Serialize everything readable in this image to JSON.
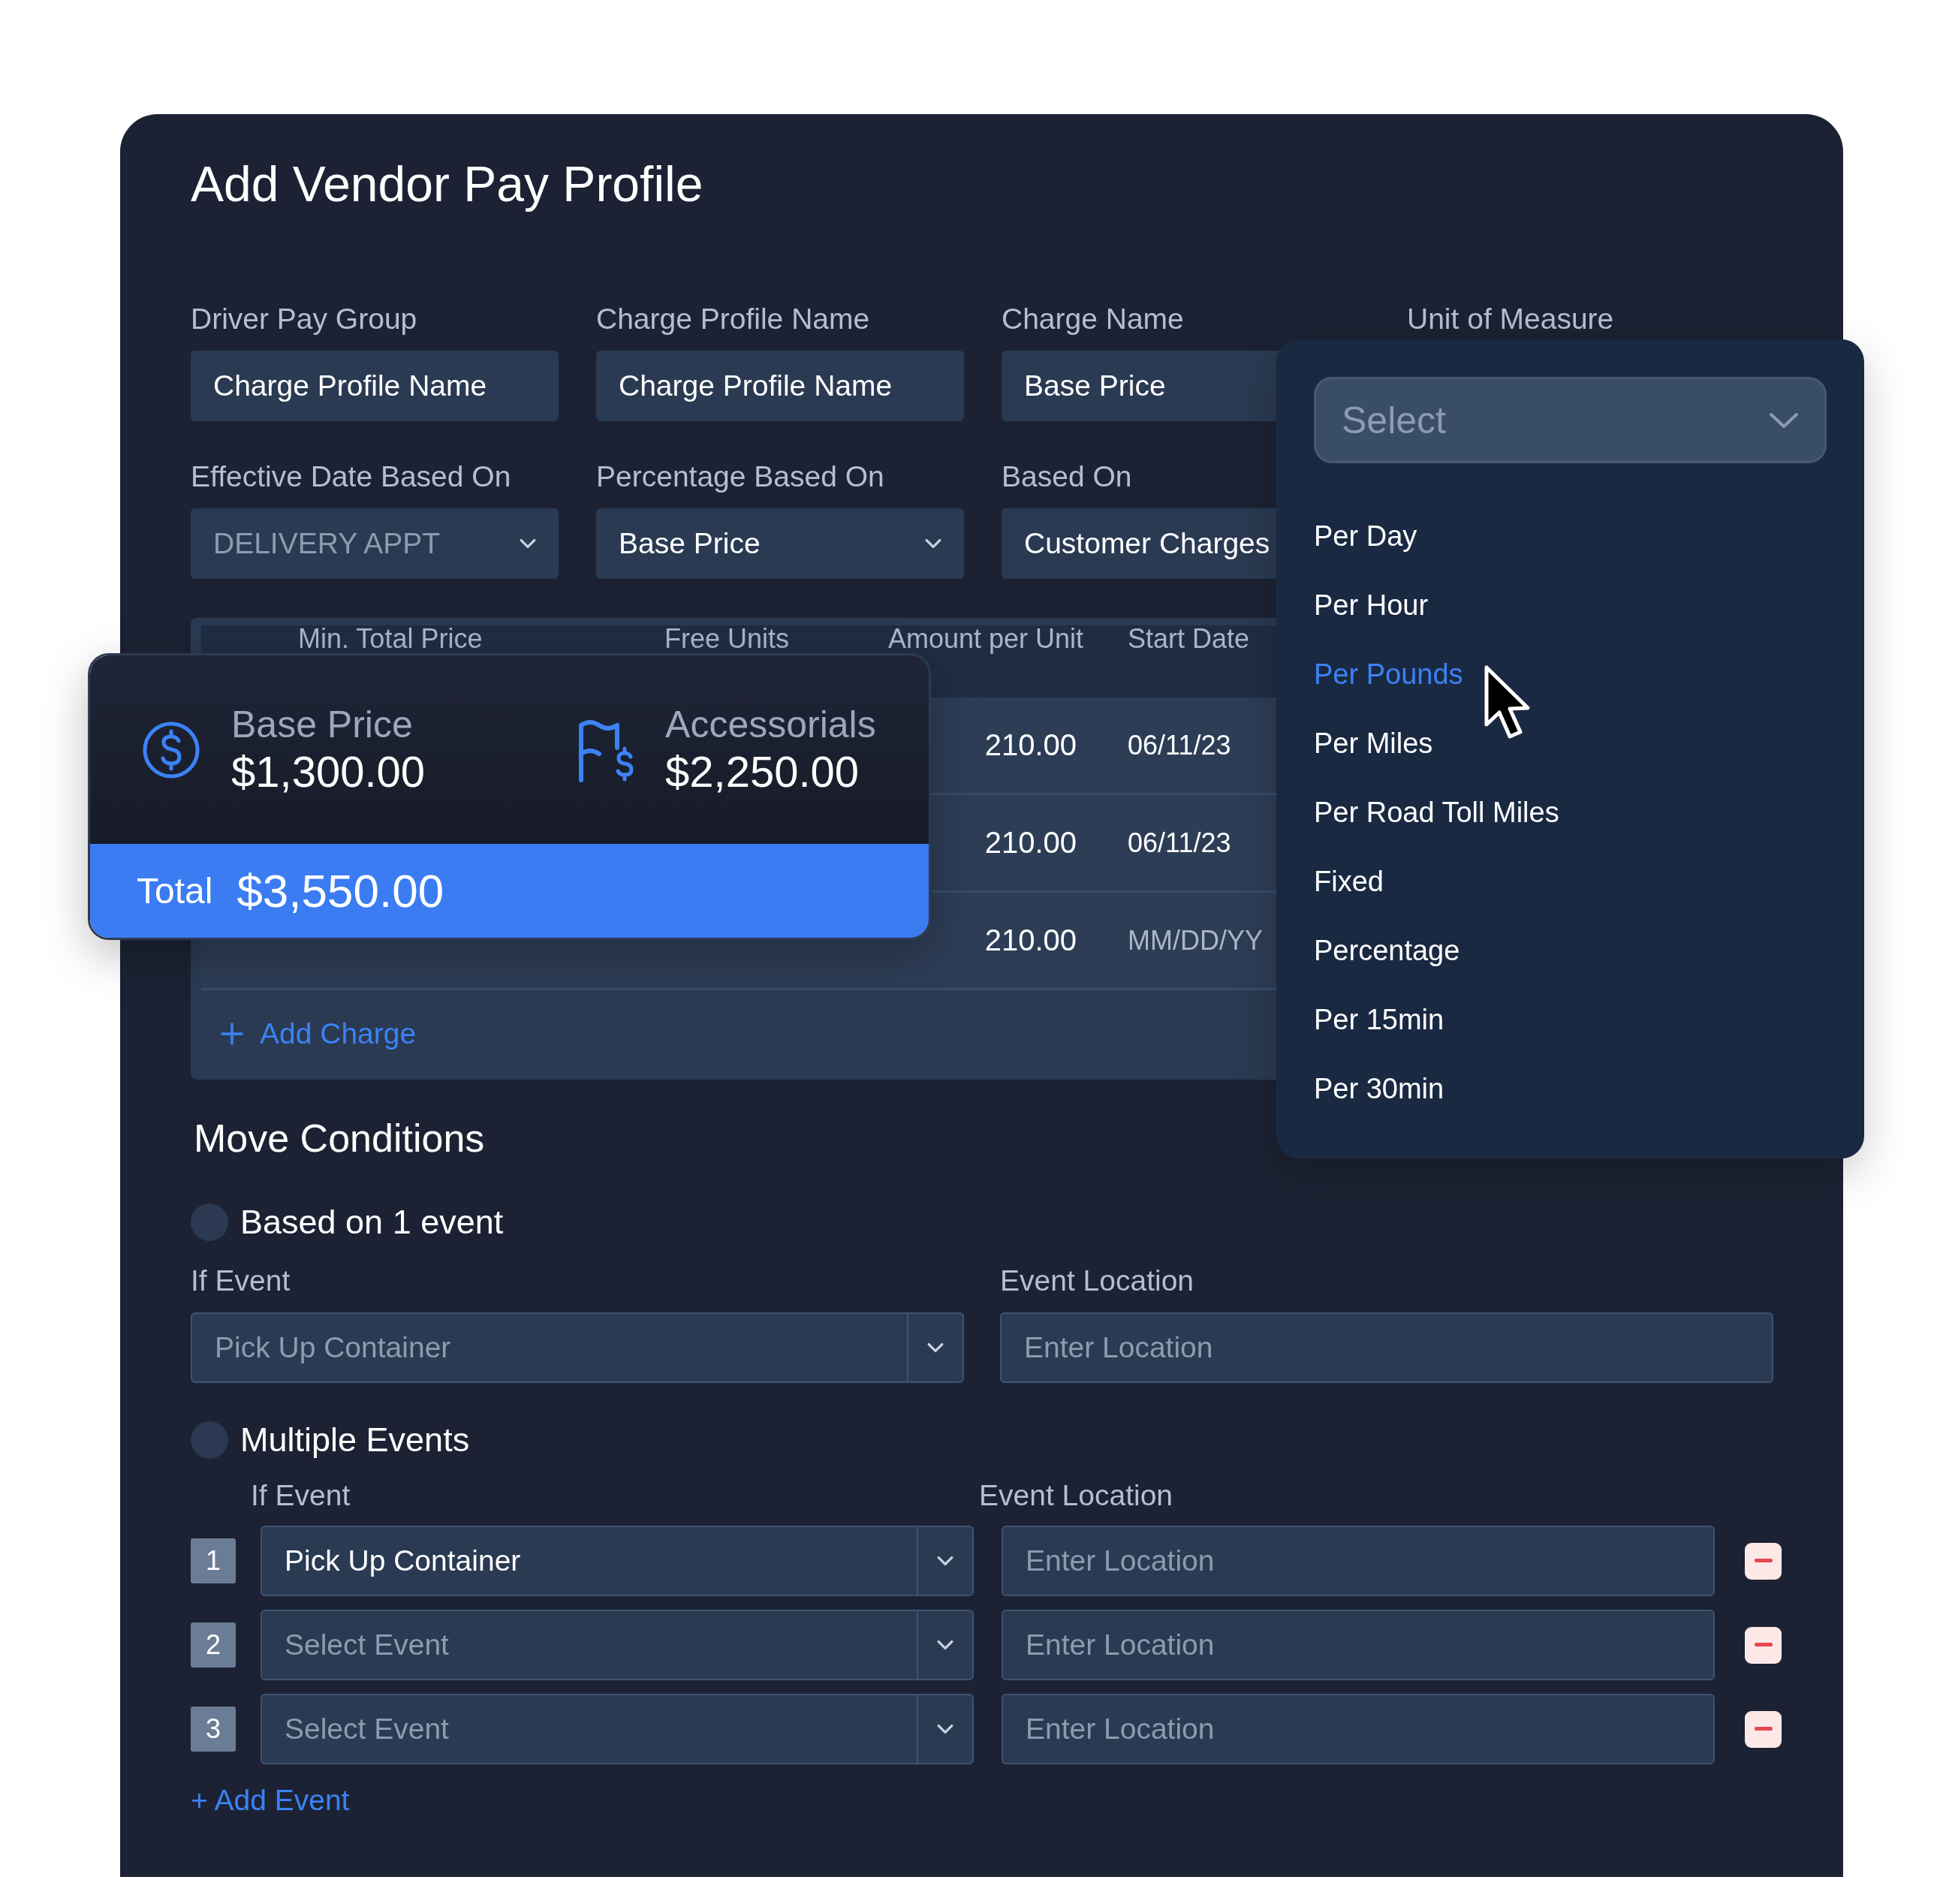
{
  "title": "Add Vendor Pay Profile",
  "form_rows": [
    {
      "fields": [
        {
          "label": "Driver Pay Group",
          "kind": "input",
          "value": "Charge Profile Name"
        },
        {
          "label": "Charge Profile Name",
          "kind": "input",
          "value": "Charge Profile Name"
        },
        {
          "label": "Charge Name",
          "kind": "input",
          "value": "Base Price"
        },
        {
          "label": "Unit of Measure"
        }
      ]
    },
    {
      "fields": [
        {
          "label": "Effective Date Based On",
          "kind": "select",
          "placeholder": "DELIVERY APPT"
        },
        {
          "label": "Percentage Based On",
          "kind": "select",
          "value": "Base Price"
        },
        {
          "label": "Based On",
          "kind": "input",
          "value": "Customer Charges"
        }
      ]
    }
  ],
  "charges_table": {
    "columns": [
      "Min. Total Price",
      "Free Units",
      "Amount per Unit",
      "Start Date"
    ],
    "rows": [
      {
        "amount": "210.00",
        "start_date": "06/11/23"
      },
      {
        "amount": "210.00",
        "start_date": "06/11/23"
      },
      {
        "amount": "210.00",
        "start_date_placeholder": "MM/DD/YY"
      }
    ],
    "add_charge": "Add Charge"
  },
  "summary": {
    "items": [
      {
        "kind": "dollar",
        "label": "Base Price",
        "amount": "$1,300.00"
      },
      {
        "kind": "flag",
        "label": "Accessorials",
        "amount": "$2,250.00"
      }
    ],
    "total_label": "Total",
    "total": "$3,550.00"
  },
  "unit_dropdown": {
    "placeholder": "Select",
    "options": [
      {
        "label": "Per Day",
        "selected": false
      },
      {
        "label": "Per Hour",
        "selected": false
      },
      {
        "label": "Per Pounds",
        "selected": true
      },
      {
        "label": "Per Miles",
        "selected": false
      },
      {
        "label": "Per Road Toll Miles",
        "selected": false
      },
      {
        "label": "Fixed",
        "selected": false
      },
      {
        "label": "Percentage",
        "selected": false
      },
      {
        "label": "Per 15min",
        "selected": false
      },
      {
        "label": "Per 30min",
        "selected": false
      }
    ]
  },
  "move_conditions": {
    "title": "Move Conditions",
    "single": {
      "option": {
        "label": "Based on 1 event",
        "selected": false
      },
      "event_label": "If Event",
      "event_placeholder": "Pick Up Container",
      "location_label": "Event Location",
      "location_placeholder": "Enter Location"
    },
    "multiple": {
      "option": {
        "label": "Multiple Events",
        "selected": false
      },
      "event_label": "If Event",
      "location_label": "Event Location",
      "rows": [
        {
          "number": "1",
          "event_value": "Pick Up Container",
          "location_placeholder": "Enter Location"
        },
        {
          "number": "2",
          "event_placeholder": "Select Event",
          "location_placeholder": "Enter Location"
        },
        {
          "number": "3",
          "event_placeholder": "Select Event",
          "location_placeholder": "Enter Location"
        }
      ],
      "add_event": "+ Add Event"
    }
  }
}
